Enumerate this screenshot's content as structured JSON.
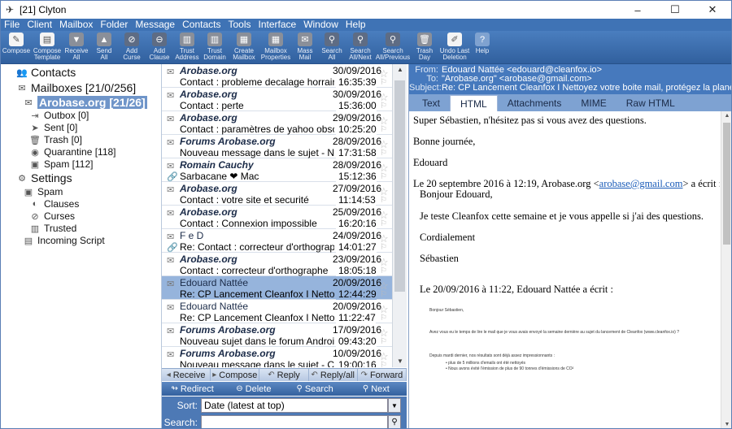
{
  "window": {
    "title": "[21] Clyton",
    "controls": [
      "–",
      "☐",
      "✕"
    ]
  },
  "menu": [
    "File",
    "Client",
    "Mailbox",
    "Folder",
    "Message",
    "Contacts",
    "Tools",
    "Interface",
    "Window",
    "Help"
  ],
  "toolbar": [
    {
      "l1": "Compose",
      "l2": "",
      "icon": "compose-icon",
      "glyph": "✎",
      "style": "w"
    },
    {
      "l1": "Compose",
      "l2": "Template",
      "icon": "template-icon",
      "glyph": "▤",
      "style": "w"
    },
    {
      "l1": "Receive",
      "l2": "All",
      "icon": "receive-icon",
      "glyph": "▼",
      "style": "g"
    },
    {
      "l1": "Send",
      "l2": "All",
      "icon": "send-icon",
      "glyph": "▲",
      "style": "g"
    },
    {
      "l1": "Add",
      "l2": "Curse",
      "icon": "curse-icon",
      "glyph": "⊘",
      "style": "d"
    },
    {
      "l1": "Add",
      "l2": "Clause",
      "icon": "clause-icon",
      "glyph": "⊖",
      "style": "d"
    },
    {
      "l1": "Trust",
      "l2": "Address",
      "icon": "trust-address-icon",
      "glyph": "▥",
      "style": "g"
    },
    {
      "l1": "Trust",
      "l2": "Domain",
      "icon": "trust-domain-icon",
      "glyph": "▥",
      "style": "g"
    },
    {
      "l1": "Create",
      "l2": "Mailbox",
      "icon": "create-mailbox-icon",
      "glyph": "▦",
      "style": "g"
    },
    {
      "l1": "Mailbox",
      "l2": "Properties",
      "icon": "mailbox-properties-icon",
      "glyph": "▦",
      "style": "g"
    },
    {
      "l1": "Mass",
      "l2": "Mail",
      "icon": "mass-mail-icon",
      "glyph": "✉",
      "style": "g"
    },
    {
      "l1": "Search",
      "l2": "All",
      "icon": "search-all-icon",
      "glyph": "⚲",
      "style": "d"
    },
    {
      "l1": "Search",
      "l2": "All/Next",
      "icon": "search-next-icon",
      "glyph": "⚲",
      "style": "d"
    },
    {
      "l1": "Search",
      "l2": "All/Previous",
      "icon": "search-previous-icon",
      "glyph": "⚲",
      "style": "d"
    },
    {
      "l1": "Trash",
      "l2": "Day",
      "icon": "trash-icon",
      "glyph": "🗑",
      "style": "g"
    },
    {
      "l1": "Undo Last",
      "l2": "Deletion",
      "icon": "undo-icon",
      "glyph": "✐",
      "style": "w"
    },
    {
      "l1": "Help",
      "l2": "",
      "icon": "help-icon",
      "glyph": "?",
      "style": "b"
    }
  ],
  "sidebar": {
    "contacts": "Contacts",
    "mailboxes": "Mailboxes [21/0/256]",
    "account": "Arobase.org [21/26]",
    "folders": [
      {
        "label": "Outbox [0]",
        "icon": "outbox-icon",
        "glyph": "⇥"
      },
      {
        "label": "Sent [0]",
        "icon": "sent-icon",
        "glyph": "➤"
      },
      {
        "label": "Trash [0]",
        "icon": "trash-folder-icon",
        "glyph": "🗑"
      },
      {
        "label": "Quarantine [118]",
        "icon": "quarantine-icon",
        "glyph": "◉"
      },
      {
        "label": "Spam [112]",
        "icon": "spam-folder-icon",
        "glyph": "▣"
      }
    ],
    "settings": "Settings",
    "settings_items": [
      {
        "label": "Spam",
        "icon": "spam-settings-icon",
        "glyph": "▣"
      },
      {
        "label": "Clauses",
        "icon": "clauses-icon",
        "glyph": "◐"
      },
      {
        "label": "Curses",
        "icon": "curses-icon",
        "glyph": "⊘"
      },
      {
        "label": "Trusted",
        "icon": "trusted-icon",
        "glyph": "▥"
      },
      {
        "label": "Incoming Script",
        "icon": "script-icon",
        "glyph": "▤"
      }
    ]
  },
  "messages": [
    {
      "from": "Arobase.org",
      "bold": true,
      "date": "30/09/2016",
      "subject": "Contact : probleme decalage horraire",
      "time": "16:35:39",
      "attach": false,
      "selected": false
    },
    {
      "from": "Arobase.org",
      "bold": true,
      "date": "30/09/2016",
      "subject": "Contact : perte",
      "time": "15:36:00",
      "attach": false,
      "selected": false
    },
    {
      "from": "Arobase.org",
      "bold": true,
      "date": "29/09/2016",
      "subject": "Contact : paramètres de yahoo obsolè",
      "time": "10:25:20",
      "attach": false,
      "selected": false
    },
    {
      "from": "Forums Arobase.org",
      "bold": true,
      "date": "28/09/2016",
      "subject": "Nouveau message dans le sujet - Nou",
      "time": "17:31:58",
      "attach": false,
      "selected": false
    },
    {
      "from": "Romain Cauchy",
      "bold": true,
      "date": "28/09/2016",
      "subject": "Sarbacane ❤ Mac",
      "time": "15:12:36",
      "attach": true,
      "selected": false
    },
    {
      "from": "Arobase.org",
      "bold": true,
      "date": "27/09/2016",
      "subject": "Contact : votre site et securité",
      "time": "11:14:53",
      "attach": false,
      "selected": false
    },
    {
      "from": "Arobase.org",
      "bold": true,
      "date": "25/09/2016",
      "subject": "Contact : Connexion impossible",
      "time": "16:20:16",
      "attach": false,
      "selected": false
    },
    {
      "from": "F e D",
      "bold": false,
      "date": "24/09/2016",
      "subject": "Re: Contact : correcteur d'orthographe",
      "time": "14:01:27",
      "attach": true,
      "selected": false
    },
    {
      "from": "Arobase.org",
      "bold": true,
      "date": "23/09/2016",
      "subject": "Contact : correcteur d'orthographe",
      "time": "18:05:18",
      "attach": false,
      "selected": false
    },
    {
      "from": "Edouard Nattée",
      "bold": false,
      "date": "20/09/2016",
      "subject": "Re: CP Lancement Cleanfox I Nettoye",
      "time": "12:44:29",
      "attach": false,
      "selected": true
    },
    {
      "from": "Edouard Nattée",
      "bold": false,
      "date": "20/09/2016",
      "subject": "Re: CP Lancement Cleanfox I Nettoye",
      "time": "11:22:47",
      "attach": false,
      "selected": false
    },
    {
      "from": "Forums Arobase.org",
      "bold": true,
      "date": "17/09/2016",
      "subject": "Nouveau sujet dans le forum Android",
      "time": "09:43:20",
      "attach": false,
      "selected": false
    },
    {
      "from": "Forums Arobase.org",
      "bold": true,
      "date": "10/09/2016",
      "subject": "Nouveau message dans le sujet - Cou",
      "time": "19:00:16",
      "attach": false,
      "selected": false
    }
  ],
  "actions1": [
    {
      "label": "Receive",
      "icon": "receive-action-icon",
      "glyph": "◂"
    },
    {
      "label": "Compose",
      "icon": "compose-action-icon",
      "glyph": "▸"
    },
    {
      "label": "Reply",
      "icon": "reply-icon",
      "glyph": "↶"
    },
    {
      "label": "Reply/all",
      "icon": "reply-all-icon",
      "glyph": "↶"
    },
    {
      "label": "Forward",
      "icon": "forward-icon",
      "glyph": "↷"
    }
  ],
  "actions2": [
    {
      "label": "Redirect",
      "icon": "redirect-icon",
      "glyph": "↬"
    },
    {
      "label": "Delete",
      "icon": "delete-icon",
      "glyph": "⊖"
    },
    {
      "label": "Search",
      "icon": "search-action-icon",
      "glyph": "⚲"
    },
    {
      "label": "Next",
      "icon": "next-icon",
      "glyph": "⚲"
    }
  ],
  "sort": {
    "label": "Sort:",
    "value": "Date (latest at top)"
  },
  "search": {
    "label": "Search:",
    "value": ""
  },
  "header": {
    "from_k": "From:",
    "from_v": "Edouard Nattée <edouard@cleanfox.io>",
    "to_k": "To:",
    "to_v": "\"Arobase.org\" <arobase@gmail.com>",
    "subject_k": "Subject:",
    "subject_v": "Re: CP Lancement Cleanfox I Nettoyez votre boite mail, protégez la planète"
  },
  "tabs": [
    "Text",
    "HTML",
    "Attachments",
    "MIME",
    "Raw HTML"
  ],
  "body": {
    "l1": "Super Sébastien, n'hésitez pas si vous avez des questions.",
    "l2": "Bonne journée,",
    "l3": "Edouard",
    "l4a": "Le 20 septembre 2016 à 12:19, Arobase.org <",
    "l4link": "arobase@gmail.com",
    "l4b": "> a écrit :",
    "l5": "Bonjour Edouard,",
    "l6": "Je teste Cleanfox cette semaine et je vous appelle si j'ai des questions.",
    "l7": "Cordialement",
    "l8": "Sébastien",
    "l9": "Le 20/09/2016 à 11:22, Edouard Nattée a écrit :",
    "t1": "Bonjour Sébastien,",
    "t2": "Avez vous eu le temps de lire le mail que je vous avais envoyé la semaine dernière au sujet du lancement de Cleanfox (www.cleanfox.io) ?",
    "t3": "Depuis mardi dernier, nos résultats sont déjà assez impressionnants :",
    "t4": "• plus de 5 millions d'emails ont été nettoyés",
    "t5": "• Nous avons évité l'émission de plus de 90 tonnes d'émissions de CO²"
  }
}
